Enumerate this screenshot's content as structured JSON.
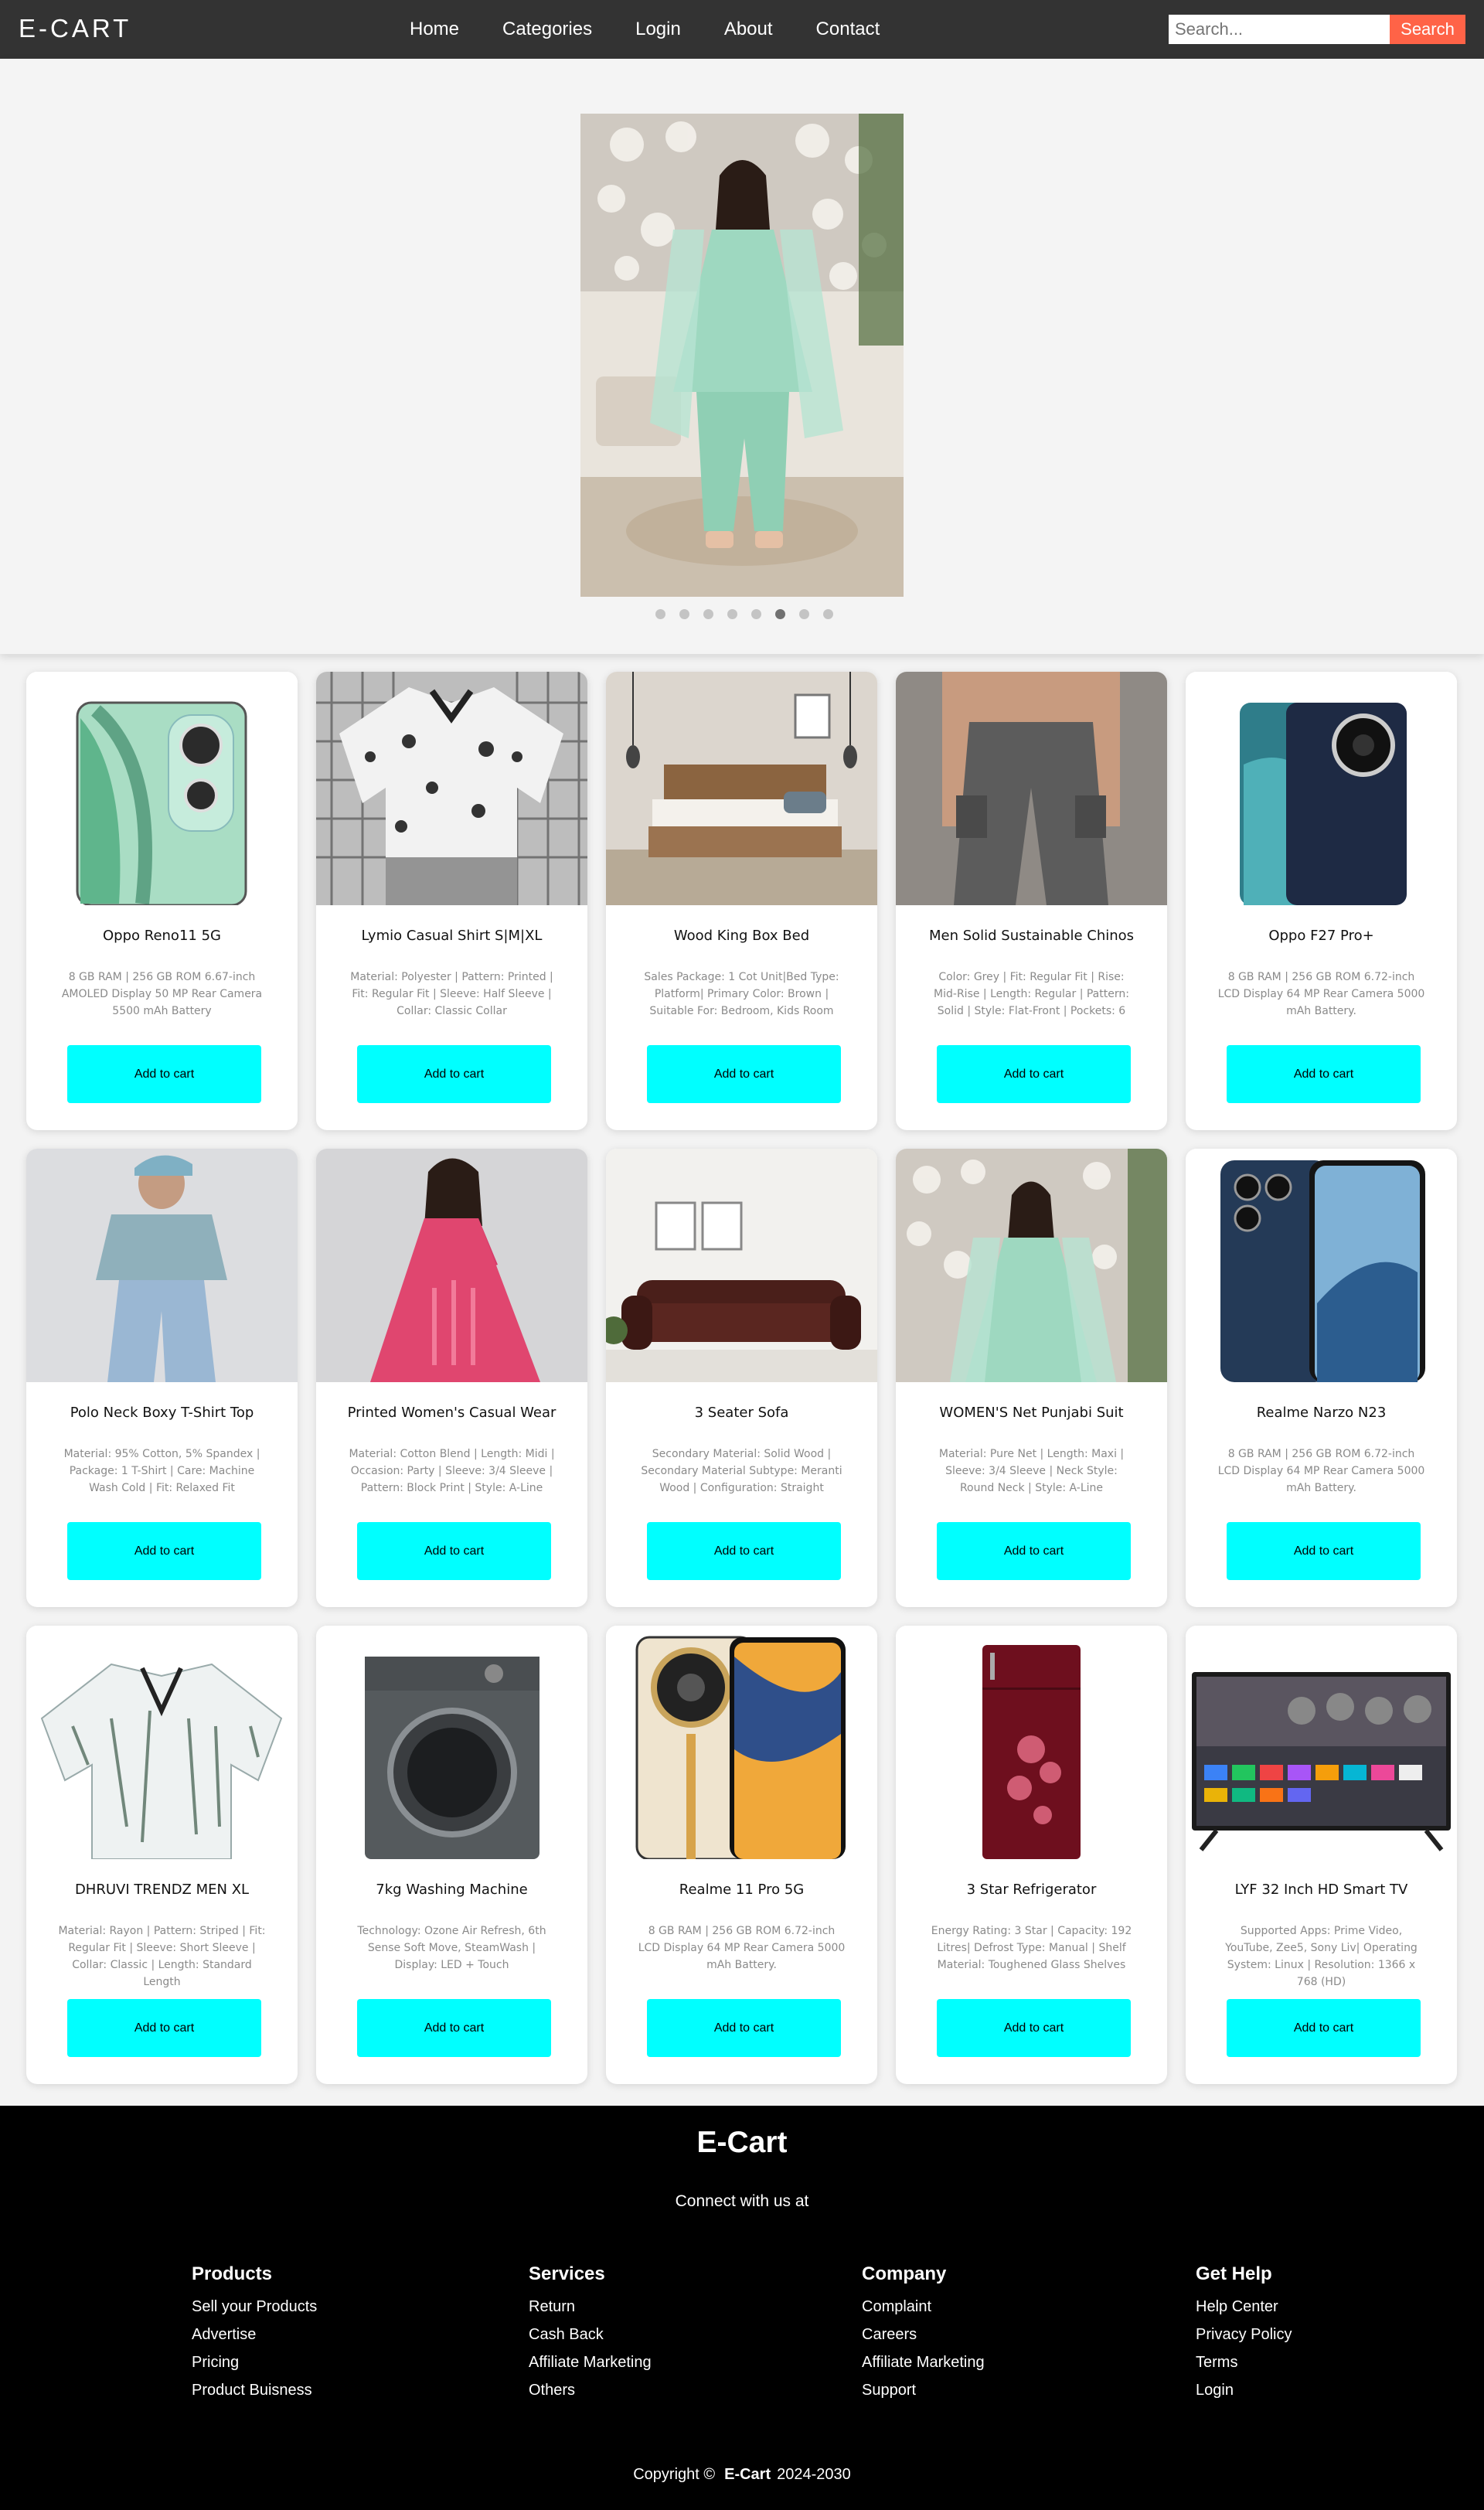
{
  "nav": {
    "brand": "E-CART",
    "links": [
      "Home",
      "Categories",
      "Login",
      "About",
      "Contact"
    ],
    "search_placeholder": "Search...",
    "search_button": "Search"
  },
  "hero": {
    "slide_count": 8,
    "active_slide": 6
  },
  "products": [
    {
      "title": "Oppo Reno11 5G",
      "desc": "8 GB RAM | 256 GB ROM 6.67-inch AMOLED Display 50 MP Rear Camera 5500 mAh Battery",
      "button": "Add to cart"
    },
    {
      "title": "Lymio Casual Shirt S|M|XL",
      "desc": "Material: Polyester | Pattern: Printed | Fit: Regular Fit | Sleeve: Half Sleeve | Collar: Classic Collar",
      "button": "Add to cart"
    },
    {
      "title": "Wood King Box Bed",
      "desc": "Sales Package: 1 Cot Unit|Bed Type: Platform| Primary Color: Brown | Suitable For: Bedroom, Kids Room",
      "button": "Add to cart"
    },
    {
      "title": "Men Solid Sustainable Chinos",
      "desc": "Color: Grey | Fit: Regular Fit | Rise: Mid-Rise | Length: Regular | Pattern: Solid | Style: Flat-Front | Pockets: 6",
      "button": "Add to cart"
    },
    {
      "title": "Oppo F27 Pro+",
      "desc": "8 GB RAM | 256 GB ROM 6.72-inch LCD Display 64 MP Rear Camera 5000 mAh Battery.",
      "button": "Add to cart"
    },
    {
      "title": "Polo Neck Boxy T-Shirt Top",
      "desc": "Material: 95% Cotton, 5% Spandex | Package: 1 T-Shirt | Care: Machine Wash Cold | Fit: Relaxed Fit",
      "button": "Add to cart"
    },
    {
      "title": "Printed Women's Casual Wear",
      "desc": "Material: Cotton Blend | Length: Midi | Occasion: Party | Sleeve: 3/4 Sleeve | Pattern: Block Print | Style: A-Line",
      "button": "Add to cart"
    },
    {
      "title": "3 Seater Sofa",
      "desc": "Secondary Material: Solid Wood | Secondary Material Subtype: Meranti Wood | Configuration: Straight",
      "button": "Add to cart"
    },
    {
      "title": "WOMEN'S Net Punjabi Suit",
      "desc": "Material: Pure Net | Length: Maxi | Sleeve: 3/4 Sleeve | Neck Style: Round Neck | Style: A-Line",
      "button": "Add to cart"
    },
    {
      "title": "Realme Narzo N23",
      "desc": "8 GB RAM | 256 GB ROM 6.72-inch LCD Display 64 MP Rear Camera 5000 mAh Battery.",
      "button": "Add to cart"
    },
    {
      "title": "DHRUVI TRENDZ MEN XL",
      "desc": "Material: Rayon | Pattern: Striped | Fit: Regular Fit | Sleeve: Short Sleeve | Collar: Classic | Length: Standard Length",
      "button": "Add to cart"
    },
    {
      "title": "7kg Washing Machine",
      "desc": "Technology: Ozone Air Refresh, 6th Sense Soft Move, SteamWash | Display: LED + Touch",
      "button": "Add to cart"
    },
    {
      "title": "Realme 11 Pro 5G",
      "desc": "8 GB RAM | 256 GB ROM 6.72-inch LCD Display 64 MP Rear Camera 5000 mAh Battery.",
      "button": "Add to cart"
    },
    {
      "title": "3 Star Refrigerator",
      "desc": "Energy Rating: 3 Star | Capacity: 192 Litres| Defrost Type: Manual | Shelf Material: Toughened Glass Shelves",
      "button": "Add to cart"
    },
    {
      "title": "LYF 32 Inch HD Smart TV",
      "desc": "Supported Apps: Prime Video, YouTube, Zee5, Sony Liv| Operating System: Linux | Resolution: 1366 x 768 (HD)",
      "button": "Add to cart"
    }
  ],
  "footer": {
    "title": "E-Cart",
    "subtitle": "Connect with us at",
    "columns": [
      {
        "heading": "Products",
        "links": [
          "Sell your Products",
          "Advertise",
          "Pricing",
          "Product Buisness"
        ]
      },
      {
        "heading": "Services",
        "links": [
          "Return",
          "Cash Back",
          "Affiliate Marketing",
          "Others"
        ]
      },
      {
        "heading": "Company",
        "links": [
          "Complaint",
          "Careers",
          "Affiliate Marketing",
          "Support"
        ]
      },
      {
        "heading": "Get Help",
        "links": [
          "Help Center",
          "Privacy Policy",
          "Terms",
          "Login"
        ]
      }
    ],
    "copyright_prefix": "Copyright ©",
    "copyright_brand": "E-Cart",
    "copyright_years": "2024-2030"
  },
  "colors": {
    "navbar": "#333333",
    "search_button": "#ff6347",
    "cart_button": "#00ffff",
    "footer": "#000000"
  }
}
